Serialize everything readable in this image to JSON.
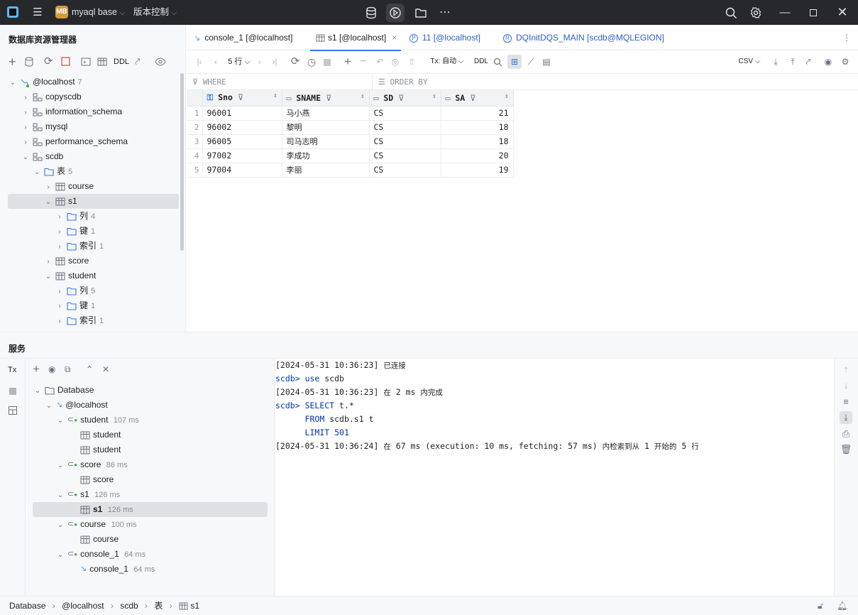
{
  "titlebar": {
    "project_badge": "MB",
    "project_name": "myaql base",
    "vcs_label": "版本控制"
  },
  "explorer": {
    "title": "数据库资源管理器",
    "toolbar": {
      "ddl": "DDL"
    },
    "tree": [
      {
        "label": "@localhost",
        "count": "7"
      },
      {
        "label": "copyscdb"
      },
      {
        "label": "information_schema"
      },
      {
        "label": "mysql"
      },
      {
        "label": "performance_schema"
      },
      {
        "label": "scdb"
      },
      {
        "label": "表",
        "count": "5"
      },
      {
        "label": "course"
      },
      {
        "label": "s1"
      },
      {
        "label": "列",
        "count": "4"
      },
      {
        "label": "键",
        "count": "1"
      },
      {
        "label": "索引",
        "count": "1"
      },
      {
        "label": "score"
      },
      {
        "label": "student"
      },
      {
        "label": "列",
        "count": "5"
      },
      {
        "label": "键",
        "count": "1"
      },
      {
        "label": "索引",
        "count": "1"
      }
    ]
  },
  "tabs": [
    {
      "label": "console_1 [@localhost]"
    },
    {
      "label": "s1 [@localhost]"
    },
    {
      "label": "11 [@localhost]"
    },
    {
      "label": "DQInitDQS_MAIN [scdb@MQLEGION]"
    }
  ],
  "grid_toolbar": {
    "rows": "5 行",
    "tx": "Tx: 自动",
    "ddl": "DDL",
    "format": "CSV"
  },
  "filter": {
    "where": "WHERE",
    "order_by": "ORDER BY"
  },
  "table": {
    "columns": [
      "Sno",
      "SNAME",
      "SD",
      "SA"
    ],
    "rows": [
      {
        "n": "1",
        "Sno": "96001",
        "SNAME": "马小燕",
        "SD": "CS",
        "SA": "21"
      },
      {
        "n": "2",
        "Sno": "96002",
        "SNAME": "黎明",
        "SD": "CS",
        "SA": "18"
      },
      {
        "n": "3",
        "Sno": "96005",
        "SNAME": "司马志明",
        "SD": "CS",
        "SA": "18"
      },
      {
        "n": "4",
        "Sno": "97002",
        "SNAME": "李成功",
        "SD": "CS",
        "SA": "20"
      },
      {
        "n": "5",
        "Sno": "97004",
        "SNAME": "李丽",
        "SD": "CS",
        "SA": "19"
      }
    ]
  },
  "services": {
    "title": "服务",
    "tx": "Tx",
    "tree": [
      {
        "label": "Database"
      },
      {
        "label": "@localhost"
      },
      {
        "label": "student",
        "time": "107 ms"
      },
      {
        "label": "student"
      },
      {
        "label": "student"
      },
      {
        "label": "score",
        "time": "86 ms"
      },
      {
        "label": "score"
      },
      {
        "label": "s1",
        "time": "126 ms"
      },
      {
        "label": "s1",
        "time": "126 ms"
      },
      {
        "label": "course",
        "time": "100 ms"
      },
      {
        "label": "course"
      },
      {
        "label": "console_1",
        "time": "64 ms"
      },
      {
        "label": "console_1",
        "time": "64 ms"
      }
    ]
  },
  "console": {
    "l1_ts": "[2024-05-31 10:36:23]",
    "l1_msg": "已连接",
    "l2_prompt": "scdb>",
    "l2_kw": "use",
    "l2_rest": "scdb",
    "l3_ts": "[2024-05-31 10:36:23]",
    "l3_a": "在",
    "l3_b": "2 ms",
    "l3_c": "内完成",
    "l4_prompt": "scdb>",
    "l4_kw": "SELECT",
    "l4_rest": "t.*",
    "l5_kw": "FROM",
    "l5_rest": "scdb.s1 t",
    "l6_kw": "LIMIT",
    "l6_num": "501",
    "l7_ts": "[2024-05-31 10:36:24]",
    "l7_a": "在",
    "l7_b": "67 ms (execution: 10 ms, fetching: 57 ms)",
    "l7_c": "内检索到从",
    "l7_d": "1",
    "l7_e": "开始的",
    "l7_f": "5",
    "l7_g": "行"
  },
  "statusbar": {
    "crumbs": [
      "Database",
      "@localhost",
      "scdb",
      "表",
      "s1"
    ]
  }
}
